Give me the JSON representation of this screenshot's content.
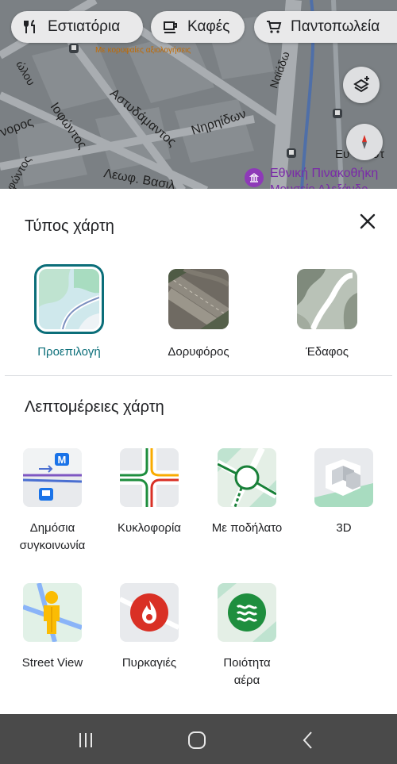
{
  "map": {
    "chips": [
      {
        "label": "Εστιατόρια",
        "icon": "restaurant-icon"
      },
      {
        "label": "Καφές",
        "icon": "coffee-icon"
      },
      {
        "label": "Παντοπωλεία",
        "icon": "grocery-cart-icon"
      }
    ],
    "streets": [
      "Ιοφώντος",
      "Αστυδάμαντος",
      "Νηρηίδων",
      "Λεωφ. Βασιλ",
      "Ναϊάδω",
      "νορος",
      "φώντος",
      "ώλου",
      "Ευ",
      "λιστ"
    ],
    "small_label": "Με κορυφαίες αξιολογήσεις",
    "poi": "Εθνική Πινακοθήκη",
    "poi_sub": "Μουσείο Αλεξάνδρ"
  },
  "sheet": {
    "map_type_title": "Τύπος χάρτη",
    "map_types": [
      {
        "label": "Προεπιλογή",
        "selected": true
      },
      {
        "label": "Δορυφόρος",
        "selected": false
      },
      {
        "label": "Έδαφος",
        "selected": false
      }
    ],
    "details_title": "Λεπτομέρειες χάρτη",
    "details": [
      {
        "line1": "Δημόσια",
        "line2": "συγκοινωνία"
      },
      {
        "line1": "Κυκλοφορία",
        "line2": ""
      },
      {
        "line1": "Με ποδήλατο",
        "line2": ""
      },
      {
        "line1": "3D",
        "line2": ""
      },
      {
        "line1": "Street View",
        "line2": ""
      },
      {
        "line1": "Πυρκαγιές",
        "line2": ""
      },
      {
        "line1": "Ποιότητα",
        "line2": "αέρα"
      }
    ]
  },
  "colors": {
    "accent": "#0b6e79",
    "map_bg": "#7d8286",
    "navbar": "#4a4a4a"
  }
}
